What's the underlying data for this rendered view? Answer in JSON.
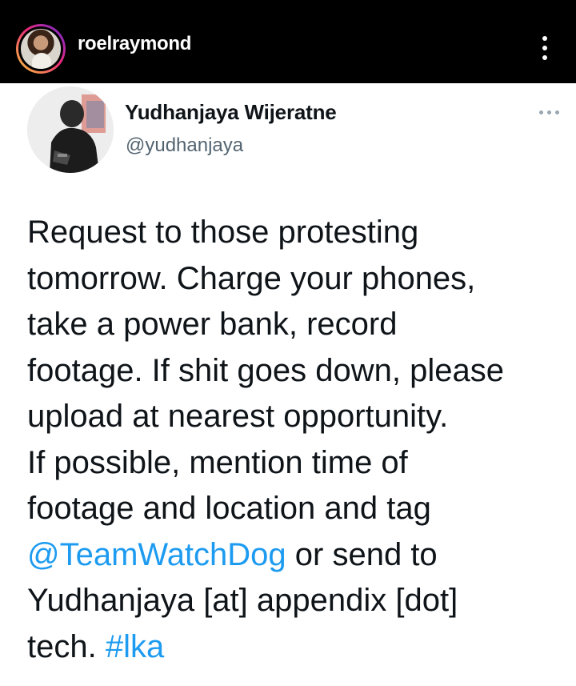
{
  "post_header": {
    "username": "roelraymond",
    "avatar_icon": "profile-photo-icon",
    "more_icon": "more-vertical-icon"
  },
  "tweet": {
    "display_name": "Yudhanjaya Wijeratne",
    "handle": "@yudhanjaya",
    "avatar_icon": "profile-photo-icon",
    "more_icon": "more-horizontal-icon",
    "lines": {
      "l1": "Request to those protesting",
      "l2": "tomorrow. Charge your phones,",
      "l3": "take a power bank, record",
      "l4": "footage. If shit goes down, please",
      "l5": "upload at nearest opportunity.",
      "l6": "If possible, mention time of",
      "l7": "footage and location and tag",
      "l8_mention": "@TeamWatchDog",
      "l8_rest": " or send to",
      "l9": "Yudhanjaya [at] appendix [dot]",
      "l10_text": "tech. ",
      "l10_hashtag": "#lka"
    }
  },
  "colors": {
    "header_bg": "#000000",
    "text": "#0f1419",
    "secondary": "#536471",
    "link": "#1d9bf0"
  }
}
